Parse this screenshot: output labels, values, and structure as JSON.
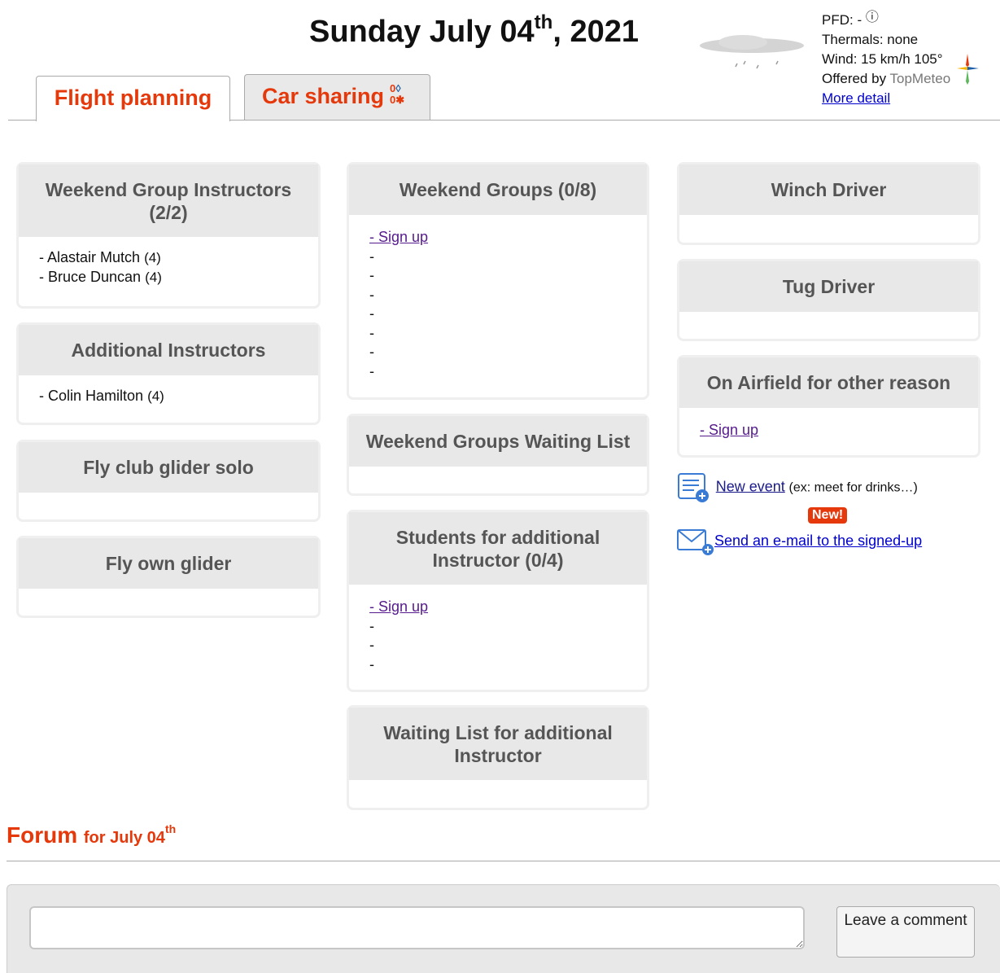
{
  "header": {
    "date_main": "Sunday July 04",
    "date_suffix": "th",
    "date_year": ", 2021"
  },
  "weather": {
    "pfd_label": "PFD: -",
    "info_icon": "ⓘ",
    "thermals": "Thermals: none",
    "wind": "Wind: 15 km/h 105°",
    "offered_by": "Offered by",
    "provider": "TopMeteo",
    "more_detail": "More detail",
    "icon": "cloud-rain-icon"
  },
  "tabs": {
    "flight_planning": "Flight planning",
    "car_sharing": "Car sharing",
    "car_count": "0",
    "walker_count": "0"
  },
  "columns": {
    "left": [
      {
        "title": "Weekend Group Instructors (2/2)",
        "entries": [
          {
            "name": "- Alastair Mutch",
            "count": "(4)"
          },
          {
            "name": "- Bruce Duncan",
            "count": "(4)"
          }
        ]
      },
      {
        "title": "Additional Instructors",
        "entries": [
          {
            "name": "- Colin Hamilton",
            "count": "(4)"
          }
        ]
      },
      {
        "title": "Fly club glider solo"
      },
      {
        "title": "Fly own glider"
      }
    ],
    "middle": [
      {
        "title": "Weekend Groups (0/8)",
        "signup": "- Sign up",
        "slots": [
          "-",
          "-",
          "-",
          "-",
          "-",
          "-",
          "-"
        ]
      },
      {
        "title": "Weekend Groups Waiting List"
      },
      {
        "title": "Students for additional Instructor (0/4)",
        "signup": "- Sign up",
        "slots": [
          "-",
          "-",
          "-"
        ]
      },
      {
        "title": "Waiting List for additional Instructor"
      }
    ],
    "right": [
      {
        "title": "Winch Driver"
      },
      {
        "title": "Tug Driver"
      },
      {
        "title": "On Airfield for other reason",
        "signup": "- Sign up"
      }
    ]
  },
  "actions": {
    "new_event": "New event",
    "new_event_hint": "(ex: meet for drinks…)",
    "new_badge": "New!",
    "send_email": "Send an e-mail to the signed-up"
  },
  "forum": {
    "title": "Forum",
    "subtitle": "for July 04",
    "subtitle_suffix": "th",
    "comment_placeholder": "",
    "button": "Leave a comment"
  }
}
